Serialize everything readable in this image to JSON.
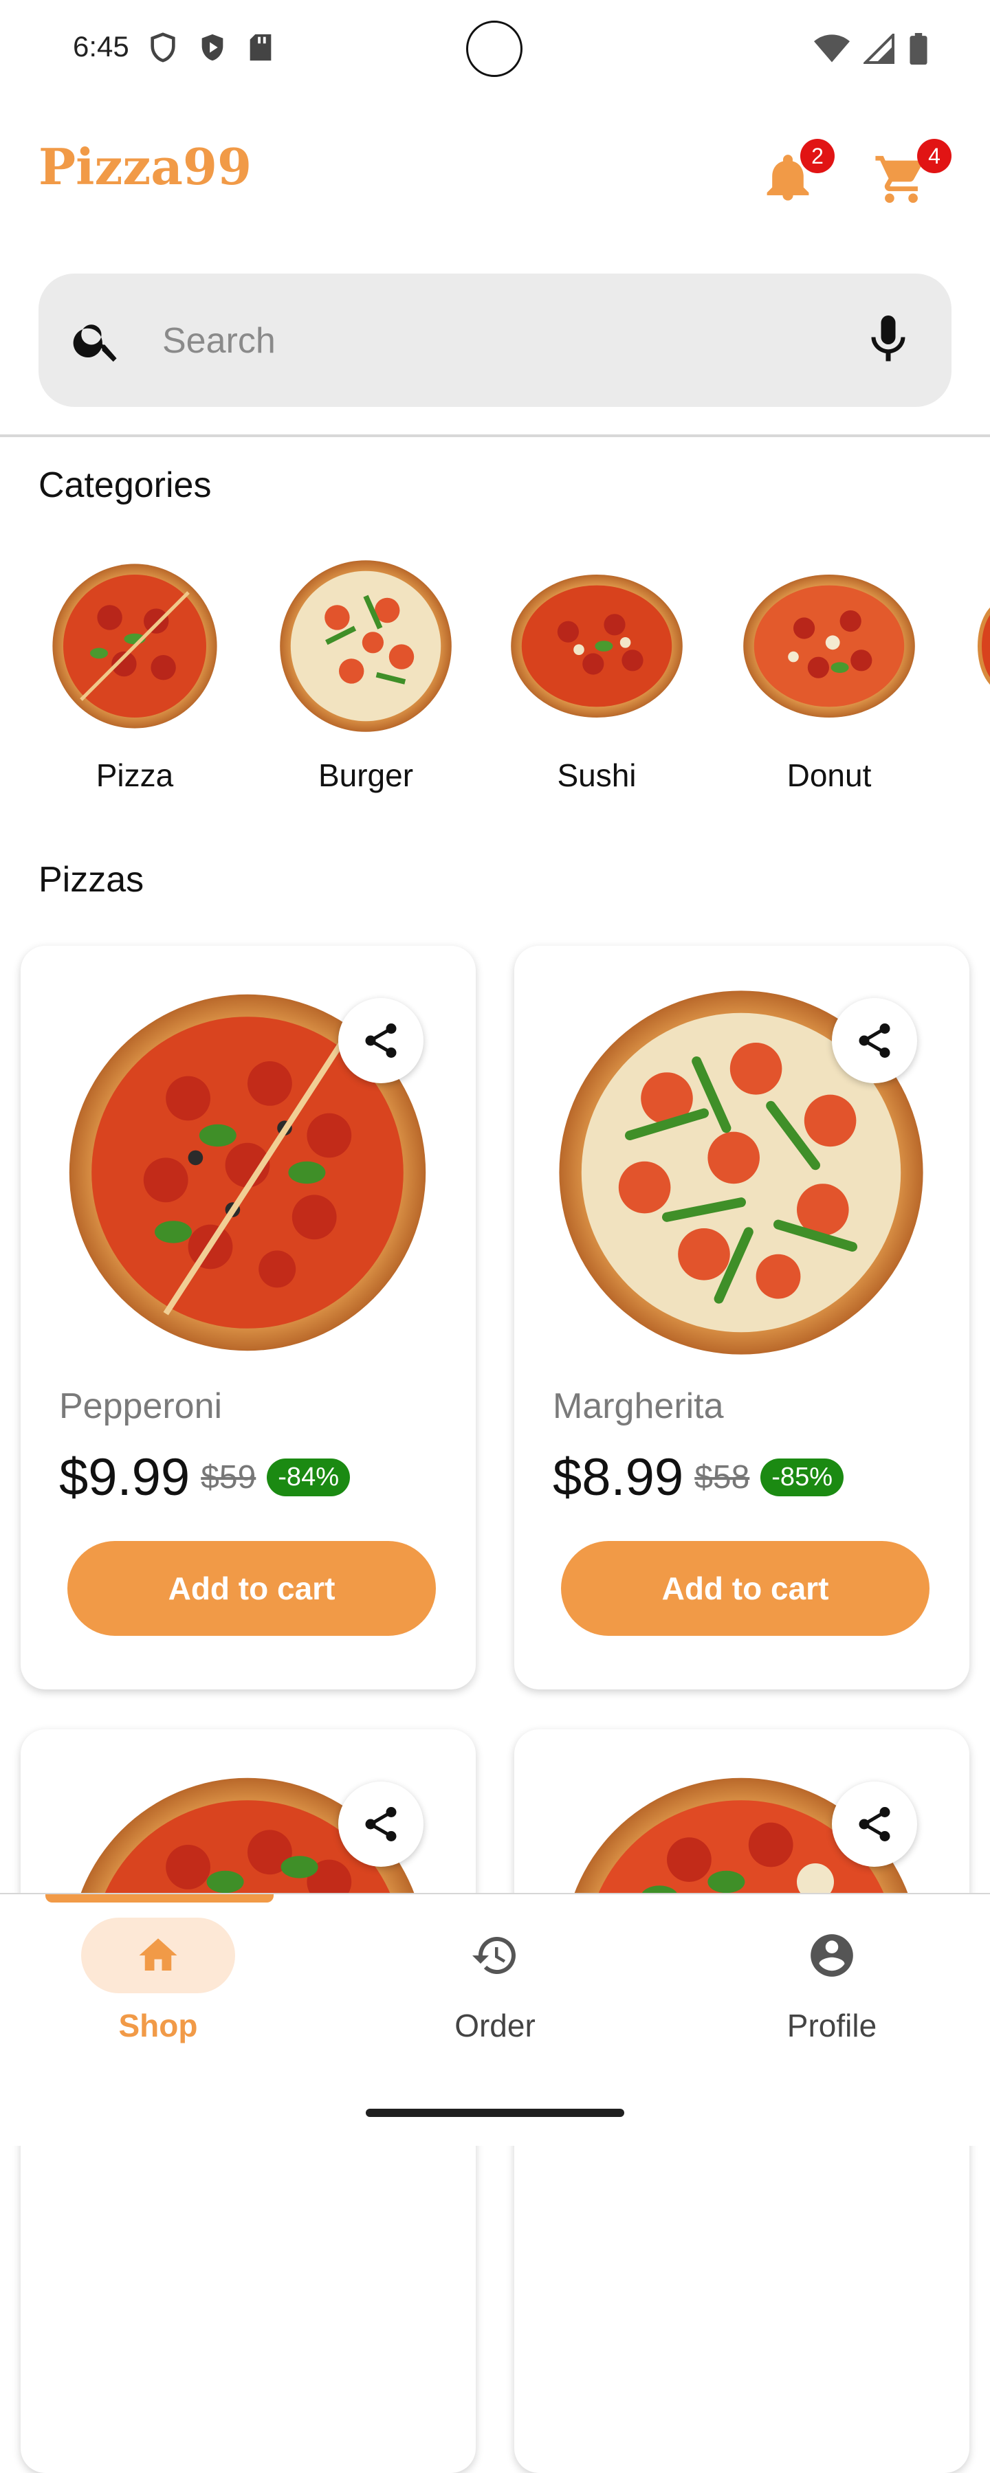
{
  "status_bar": {
    "time": "6:45"
  },
  "app": {
    "brand": "Pizza99",
    "notifications_count": "2",
    "cart_count": "4",
    "accent": "#F19A47"
  },
  "search": {
    "placeholder": "Search"
  },
  "categories": {
    "title": "Categories",
    "items": [
      {
        "label": "Pizza"
      },
      {
        "label": "Burger"
      },
      {
        "label": "Sushi"
      },
      {
        "label": "Donut"
      }
    ]
  },
  "pizzas": {
    "title": "Pizzas",
    "products": [
      {
        "name": "Pepperoni",
        "price": "$9.99",
        "old_price": "$59",
        "discount": "-84%",
        "cta": "Add to cart"
      },
      {
        "name": "Margherita",
        "price": "$8.99",
        "old_price": "$58",
        "discount": "-85%",
        "cta": "Add to cart"
      }
    ]
  },
  "bottom_nav": {
    "items": [
      {
        "label": "Shop",
        "icon": "home-icon",
        "active": true
      },
      {
        "label": "Order",
        "icon": "history-icon",
        "active": false
      },
      {
        "label": "Profile",
        "icon": "account-icon",
        "active": false
      }
    ]
  }
}
